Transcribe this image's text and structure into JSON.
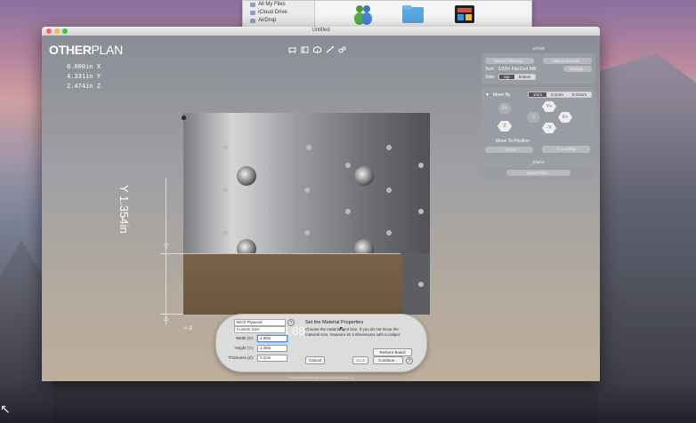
{
  "finder": {
    "items": [
      "All My Files",
      "iCloud Drive",
      "AirDrop"
    ]
  },
  "window": {
    "title": "Untitled"
  },
  "app": {
    "logo_bold": "OTHER",
    "logo_light": "PLAN",
    "coords": {
      "x": "0.000in X",
      "y": "4.331in Y",
      "z": "2.474in Z"
    },
    "y_dimension": "Y 1.354in",
    "x_dimension": "X 4.88",
    "status_text": "Plot/entry/item/3.0/5.2/4.0.0/Next/1/4/5.17"
  },
  "panel": {
    "setup_header": "setup",
    "select_fixturing": "Select Fixturing...",
    "select_material": "Select Material...",
    "tool_label": "Tool:",
    "tool_value": "1/32in Flat End Mill",
    "change_label": "Change...",
    "side_label": "Side:",
    "side_top": "top",
    "side_bottom": "bottom",
    "move_by_label": "Move By",
    "move_by_options": [
      "1mm",
      "0.1mm",
      "0.01mm"
    ],
    "jog": {
      "z_plus": "Z+",
      "z_minus": "Z",
      "y_plus": "Y+",
      "y_minus": "-Y",
      "x_plus": "X+",
      "x_minus": "-X"
    },
    "move_to_position": "Move To Position",
    "home_label": "Home",
    "loading_label": "Loading",
    "plans_header": "plans",
    "import_files": "Import Files..."
  },
  "dialog": {
    "material_type": "Birch Plywood",
    "custom_size": "Custom Size",
    "width_label": "Width (X):",
    "width_value": "4.88in",
    "height_label": "Height (Y):",
    "height_value": "1.35in",
    "thickness_label": "Thickness (Z):",
    "thickness_value": "0.22in",
    "title": "Set the Material Properties",
    "description": "Choose the material and size. If you do not know the material size, measure its 3 dimensions with a caliper.",
    "restore_board": "Restore Board",
    "cancel": "Cancel",
    "back": "Back",
    "continue": "Continue..."
  }
}
